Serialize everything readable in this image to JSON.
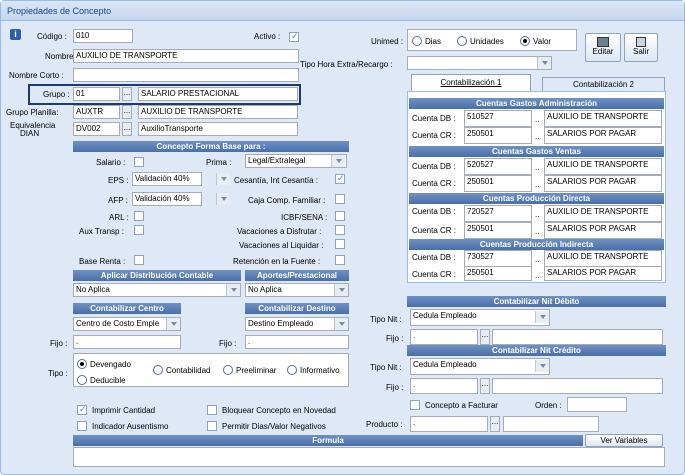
{
  "window": {
    "title": "Propiedades de Concepto"
  },
  "codigo": {
    "label": "Código :",
    "value": "010"
  },
  "activo": {
    "label": "Activo :"
  },
  "nombre": {
    "label": "Nombre :",
    "value": "AUXILIO DE TRANSPORTE"
  },
  "nombre_corto": {
    "label": "Nombre Corto :"
  },
  "grupo": {
    "label": "Grupo :",
    "code": "01",
    "desc": "SALARIO PRESTACIONAL"
  },
  "grupo_planilla": {
    "label": "Grupo Planilla:",
    "code": "AUXTR",
    "desc": "AUXILIO DE TRANSPORTE"
  },
  "equivalencia": {
    "label1": "Equivalencia",
    "label2": "DIAN",
    "code": "DV002",
    "desc": "AuxilioTransporte"
  },
  "unimed": {
    "label": "Unimed :",
    "opt1": "Dias",
    "opt2": "Unidades",
    "opt3": "Valor"
  },
  "tipo_hora": {
    "label": "Tipo Hora Extra/Recargo :"
  },
  "buttons": {
    "editar": "Editar",
    "salir": "Salir",
    "ver_variables": "Ver Variables"
  },
  "tabs": {
    "tab1": "Contabilización 1",
    "tab2": "Contabilización 2"
  },
  "cuentas": {
    "g1": {
      "title": "Cuentas Gastos Administración",
      "db_label": "Cuenta DB :",
      "db_code": "510527",
      "db_desc": "AUXILIO DE TRANSPORTE",
      "cr_label": "Cuenta CR :",
      "cr_code": "250501",
      "cr_desc": "SALARIOS POR PAGAR"
    },
    "g2": {
      "title": "Cuentas Gastos Ventas",
      "db_label": "Cuenta DB :",
      "db_code": "520527",
      "db_desc": "AUXILIO DE TRANSPORTE",
      "cr_label": "Cuenta CR :",
      "cr_code": "250501",
      "cr_desc": "SALARIOS POR PAGAR"
    },
    "g3": {
      "title": "Cuentas Producción Directa",
      "db_label": "Cuenta DB :",
      "db_code": "720527",
      "db_desc": "AUXILIO DE TRANSPORTE",
      "cr_label": "Cuenta CR :",
      "cr_code": "250501",
      "cr_desc": "SALARIOS POR PAGAR"
    },
    "g4": {
      "title": "Cuentas Producción Indirecta",
      "db_label": "Cuenta DB :",
      "db_code": "730527",
      "db_desc": "AUXILIO DE TRANSPORTE",
      "cr_label": "Cuenta CR :",
      "cr_code": "250501",
      "cr_desc": "SALARIOS POR PAGAR"
    }
  },
  "forma_base": {
    "title": "Concepto Forma Base para :",
    "salario": "Salario :",
    "prima": "Prima :",
    "prima_val": "Legal/Extralegal",
    "eps": "EPS :",
    "eps_val": "Validación 40%",
    "cesantia": "Cesantía, Int Cesantía :",
    "afp": "AFP :",
    "afp_val": "Validación 40%",
    "caja": "Caja Comp. Familiar :",
    "arl": "ARL :",
    "icbf": "ICBF/SENA :",
    "aux": "Aux Transp :",
    "vac_disf": "Vacaciones a Disfrutar :",
    "vac_liq": "Vacaciones al Liquidar :",
    "base_renta": "Base Renta :",
    "retencion": "Retención en la Fuente :"
  },
  "distribucion": {
    "title": "Aplicar Distribución Contable",
    "value": "No Aplica"
  },
  "aportes": {
    "title": "Aportes/Prestacional",
    "value": "No Aplica"
  },
  "centro": {
    "title": "Contabilizar Centro",
    "value": "Centro de Costo Emple",
    "fijo": "Fijo :",
    "fijo_val": "."
  },
  "destino": {
    "title": "Contabilizar Destino",
    "value": "Destino Empleado",
    "fijo": "Fijo :",
    "fijo_val": "."
  },
  "tipo": {
    "label": "Tipo :",
    "opt1": "Devengado",
    "opt2": "Contabilidad",
    "opt3": "Preeliminar",
    "opt4": "Informativo",
    "opt5": "Deducible"
  },
  "nit_debito": {
    "title": "Contabilizar Nit Débito",
    "tipo_label": "Tipo Nit :",
    "tipo_val": "Cedula Empleado",
    "fijo": "Fijo :",
    "fijo_val": "."
  },
  "nit_credito": {
    "title": "Contabilizar Nit Crédito",
    "tipo_label": "Tipo Nit :",
    "tipo_val": "Cedula Empleado",
    "fijo": "Fijo :",
    "fijo_val": "."
  },
  "checks": {
    "imprimir": "Imprimir Cantidad",
    "indicador": "Indicador Ausentismo",
    "bloquear": "Bloquear Concepto en Novedad",
    "permitir": "Permitir Dias/Valor Negativos",
    "concepto_fact": "Concepto a Facturar",
    "orden": "Orden :"
  },
  "producto": {
    "label": "Producto :",
    "value": "."
  },
  "formula": {
    "title": "Formula"
  }
}
